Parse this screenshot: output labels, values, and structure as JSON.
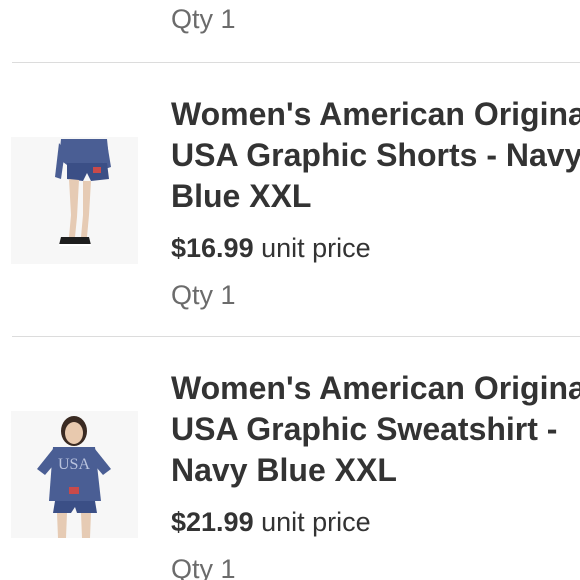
{
  "top_item": {
    "qty": "Qty 1"
  },
  "items": [
    {
      "title": "Women's American Original USA Graphic Shorts - Navy Blue XXL",
      "price": "$16.99",
      "price_suffix": "unit price",
      "qty": "Qty 1",
      "image_icon": "shorts-product-photo"
    },
    {
      "title": "Women's American Original USA Graphic Sweatshirt - Navy Blue XXL",
      "price": "$21.99",
      "price_suffix": "unit price",
      "qty": "Qty 1",
      "image_icon": "sweatshirt-product-photo"
    }
  ],
  "colors": {
    "text": "#333333",
    "muted": "#6b6b6b",
    "divider": "#dcdcdc",
    "navy": "#3b4f86"
  }
}
